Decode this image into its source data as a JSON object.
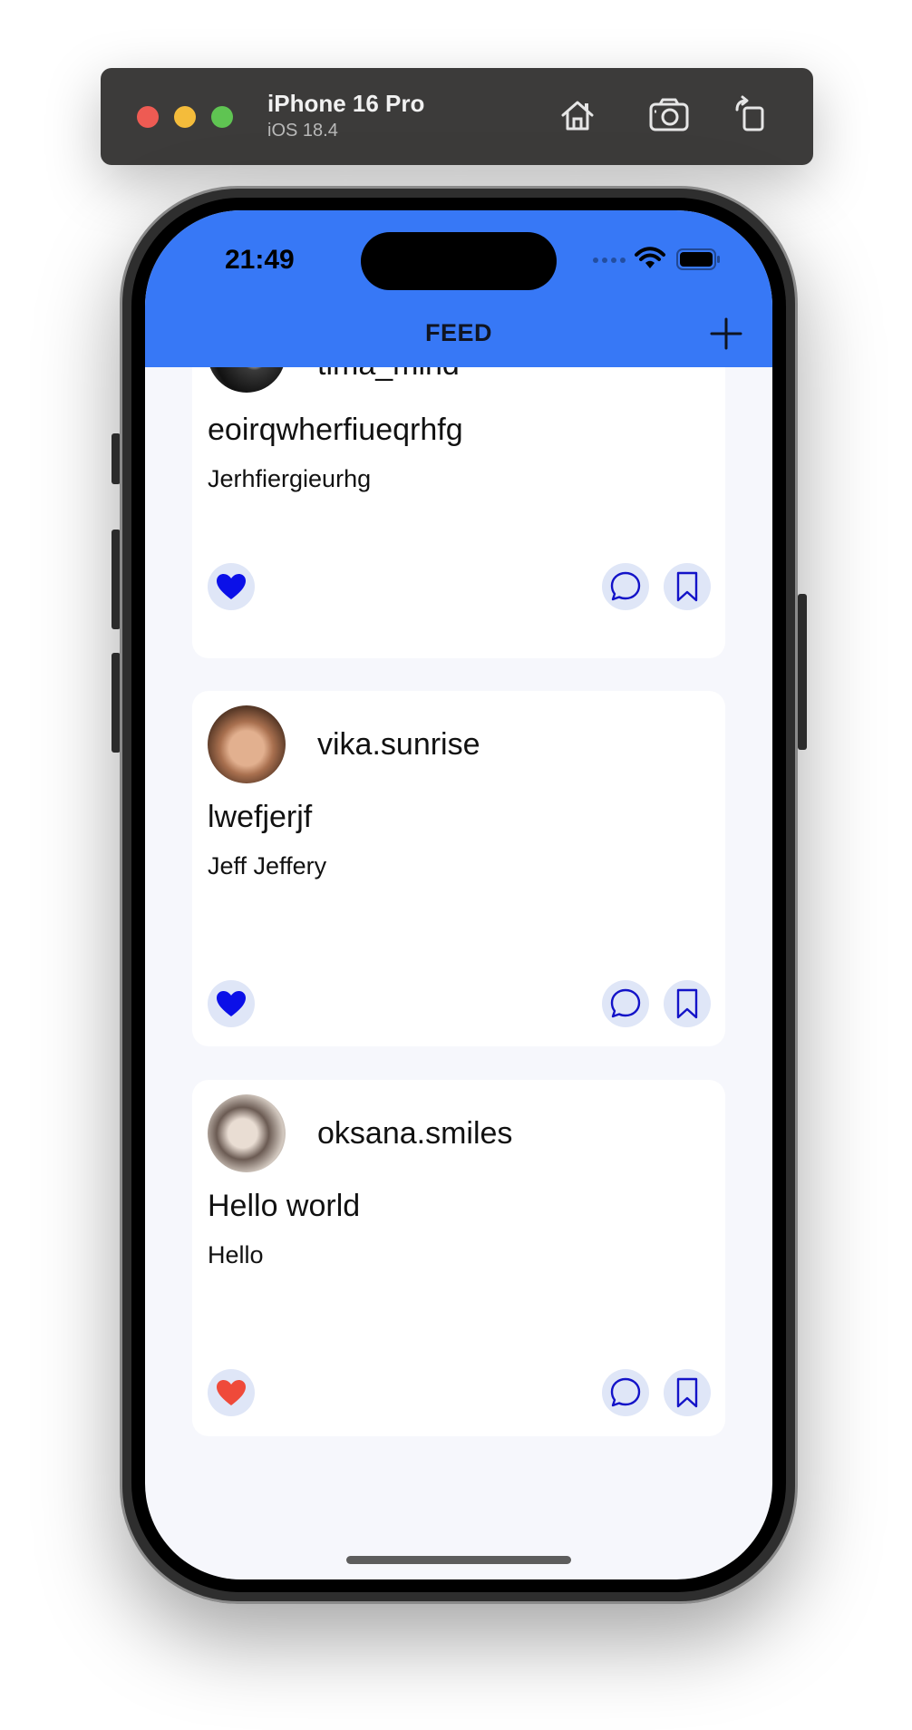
{
  "simulator": {
    "device_name": "iPhone 16 Pro",
    "os_version": "iOS 18.4",
    "toolbar_icons": [
      "home-icon",
      "screenshot-icon",
      "rotate-icon"
    ]
  },
  "status_bar": {
    "time": "21:49"
  },
  "navbar": {
    "title": "FEED",
    "add_icon": "plus-icon",
    "background_color": "#3778f6"
  },
  "posts": [
    {
      "username": "tima_mind",
      "title": "eoirqwherfiueqrhfg",
      "body": "Jerhfiergieurhg",
      "liked_color": "#0b10e8"
    },
    {
      "username": "vika.sunrise",
      "title": "lwefjerjf",
      "body": "Jeff Jeffery",
      "liked_color": "#0b10e8"
    },
    {
      "username": "oksana.smiles",
      "title": "Hello world",
      "body": "Hello",
      "liked_color": "#ef4a3a"
    }
  ],
  "colors": {
    "accent_icon": "#1313c8",
    "icon_button_bg": "#dfe6f7",
    "screen_bg": "#f6f7fc"
  }
}
